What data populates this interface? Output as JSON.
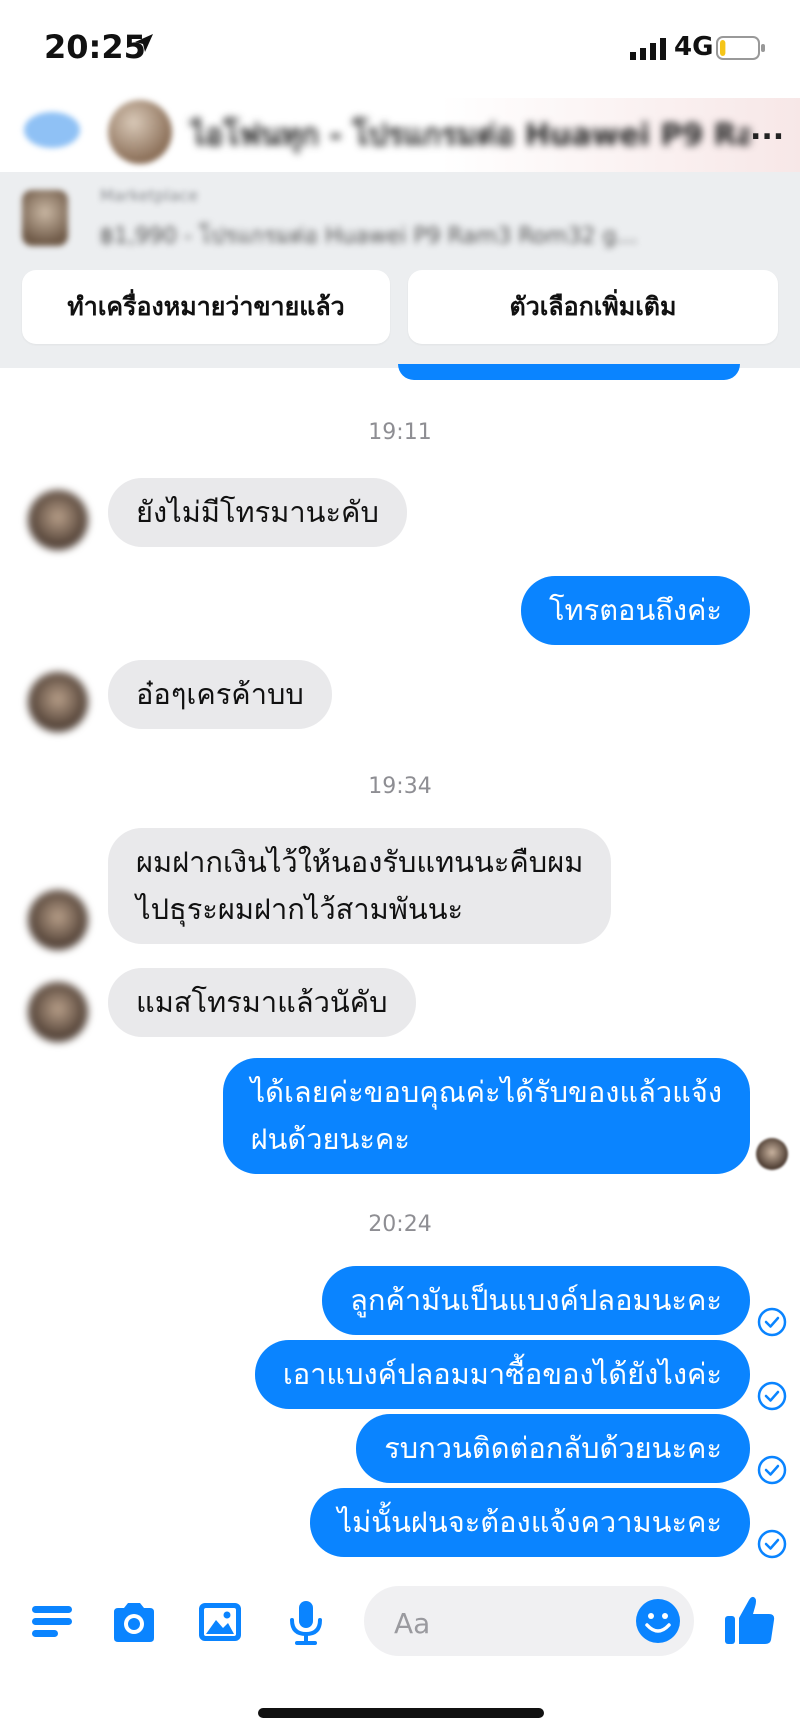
{
  "status_bar": {
    "time": "20:25",
    "network": "4G",
    "battery_level": 0.15
  },
  "header": {
    "title_blurred": "ไอโฟนทุก - โปรแกรมต่อ Huawei P9 Ram",
    "ellipsis": "..."
  },
  "listing": {
    "seller_blurred": "Marketplace",
    "title_blurred": "฿1,990 - โปรแกรมต่อ Huawei P9 Ram3 Rom32 g...",
    "mark_sold_label": "ทำเครื่องหมายว่าขายแล้ว",
    "more_options_label": "ตัวเลือกเพิ่มเติม"
  },
  "timestamps": [
    "19:11",
    "19:34",
    "20:24"
  ],
  "messages": {
    "m1": "ยังไม่มีโทรมานะคับ",
    "m2": "โทรตอนถึงค่ะ",
    "m3": "อ๋อๆเครค้าบบ",
    "m4": "ผมฝากเงินไว้ให้นองรับแทนนะคืบผม\nไปธุระผมฝากไว้สามพันนะ",
    "m5": "แมสโทรมาแล้วนัคับ",
    "m6": "ได้เลยค่ะขอบคุณค่ะได้รับของแล้วแจ้ง\nฝนด้วยนะคะ",
    "m7": "ลูกค้ามันเป็นแบงค์ปลอมนะคะ",
    "m8": "เอาแบงค์ปลอมมาซื้อของได้ยังไงค่ะ",
    "m9": "รบกวนติดต่อกลับด้วยนะคะ",
    "m10": "ไม่นั้นฝนจะต้องแจ้งความนะคะ"
  },
  "composer": {
    "placeholder": "Aa"
  },
  "icons": {
    "menu": "menu-icon",
    "camera": "camera-icon",
    "gallery": "image-icon",
    "mic": "microphone-icon",
    "emoji": "emoji-icon",
    "like": "thumbs-up-icon",
    "read": "check-circle-icon",
    "location": "location-arrow-icon"
  },
  "colors": {
    "accent": "#0a84ff",
    "incoming_bubble": "#e9e9eb",
    "timestamp": "#8e8e93",
    "banner_bg": "#eceef0"
  }
}
